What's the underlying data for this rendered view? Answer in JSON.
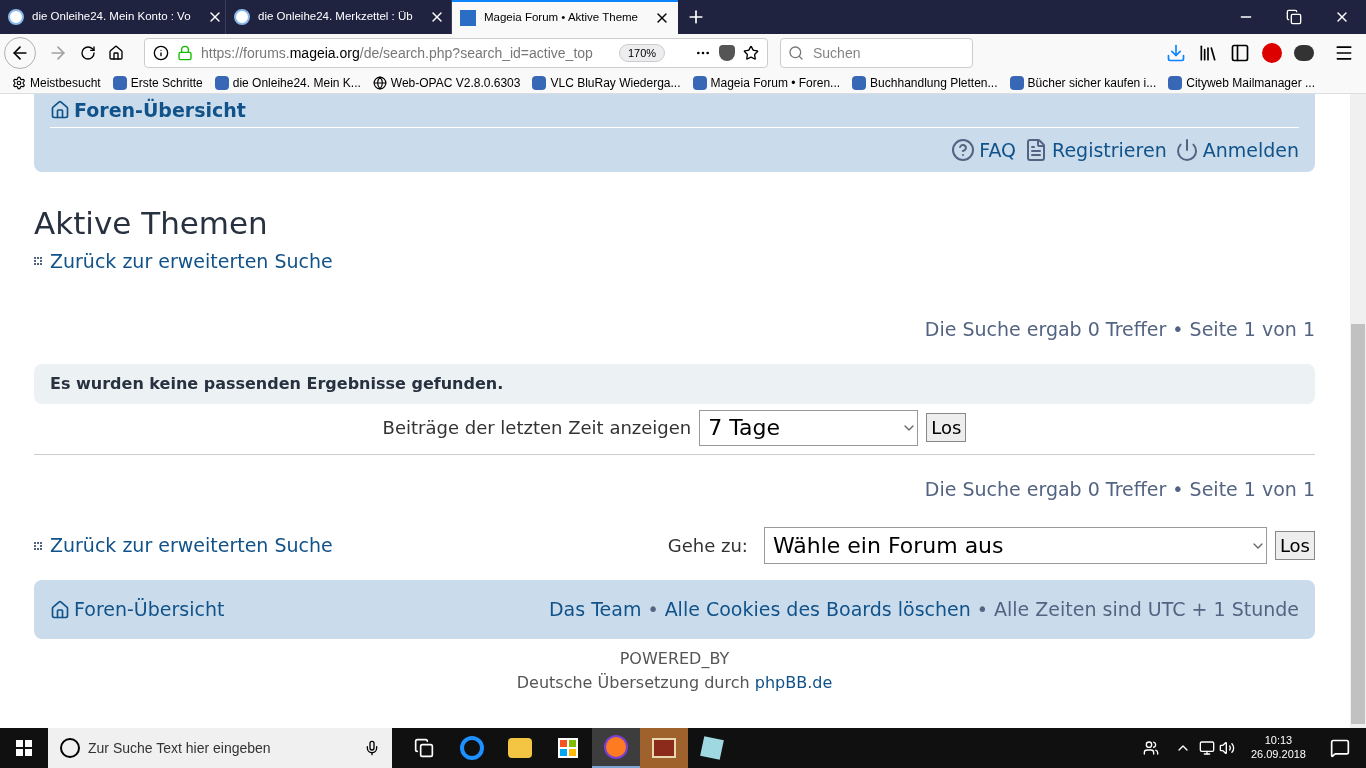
{
  "browser": {
    "tabs": [
      {
        "title": "die Onleihe24. Mein Konto : Vo",
        "selected": false
      },
      {
        "title": "die Onleihe24. Merkzettel : Üb",
        "selected": false
      },
      {
        "title": "Mageia Forum • Aktive Theme",
        "selected": true
      }
    ],
    "url": {
      "prefix": "https://forums.",
      "domain": "mageia.org",
      "path": "/de/search.php?search_id=active_top"
    },
    "zoom": "170%",
    "search": {
      "placeholder": "Suchen"
    },
    "bookmarks": [
      "Meistbesucht",
      "Erste Schritte",
      "die Onleihe24. Mein K...",
      "Web-OPAC V2.8.0.6303",
      "VLC BluRay Wiederga...",
      "Mageia Forum • Foren...",
      "Buchhandlung Pletten...",
      "Bücher sicher kaufen i...",
      "Cityweb Mailmanager ..."
    ]
  },
  "page": {
    "header": {
      "home_link": "Foren-Übersicht",
      "links": [
        "FAQ",
        "Registrieren",
        "Anmelden"
      ]
    },
    "title": "Aktive Themen",
    "back_link": "Zurück zur erweiterten Suche",
    "pagination_top": "Die Suche ergab 0 Treffer • Seite 1 von 1",
    "notice": "Es wurden keine passenden Ergebnisse gefunden.",
    "time_filter": {
      "label": "Beiträge der letzten Zeit anzeigen",
      "value": "7 Tage",
      "button": "Los"
    },
    "pagination_bottom": "Die Suche ergab 0 Treffer • Seite 1 von 1",
    "back_link_bottom": "Zurück zur erweiterten Suche",
    "jump": {
      "label": "Gehe zu:",
      "value": "Wähle ein Forum aus",
      "button": "Los"
    },
    "footer": {
      "home_link": "Foren-Übersicht",
      "links": [
        "Das Team",
        "Alle Cookies des Boards löschen"
      ],
      "separator": "•",
      "note": "Alle Zeiten sind UTC + 1 Stunde"
    },
    "powered": "POWERED_BY",
    "translation": "Deutsche Übersetzung durch",
    "translation_link": "phpBB.de"
  },
  "taskbar": {
    "search": {
      "placeholder": "Zur Suche Text hier eingeben"
    },
    "apps": [
      {
        "kind": "taskview",
        "selected": false
      },
      {
        "kind": "edge",
        "selected": false
      },
      {
        "kind": "explorer",
        "selected": false
      },
      {
        "kind": "store",
        "selected": false
      },
      {
        "kind": "firefox",
        "selected": true
      },
      {
        "kind": "reader",
        "selected": false
      },
      {
        "kind": "notes",
        "selected": false
      }
    ],
    "time": "10:13",
    "date": "26.09.2018"
  }
}
